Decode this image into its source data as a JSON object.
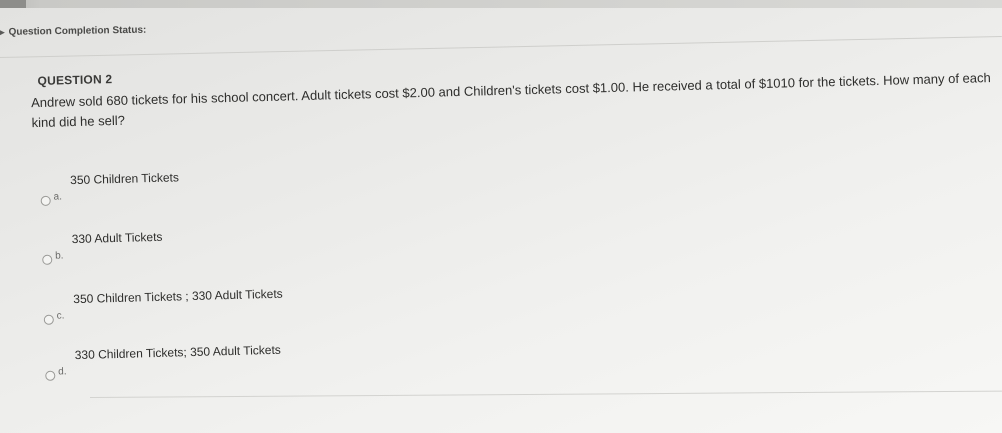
{
  "status": {
    "label": "Question Completion Status:"
  },
  "question": {
    "header": "QUESTION 2",
    "text": "Andrew sold 680 tickets for his school concert. Adult tickets cost $2.00 and Children's tickets cost $1.00. He received a total of $1010 for the tickets. How many of each kind did he sell?",
    "options": [
      {
        "letter": "a.",
        "label": "350 Children Tickets"
      },
      {
        "letter": "b.",
        "label": "330 Adult Tickets"
      },
      {
        "letter": "c.",
        "label": "350 Children Tickets ; 330 Adult Tickets"
      },
      {
        "letter": "d.",
        "label": "330 Children Tickets; 350 Adult Tickets"
      }
    ]
  }
}
